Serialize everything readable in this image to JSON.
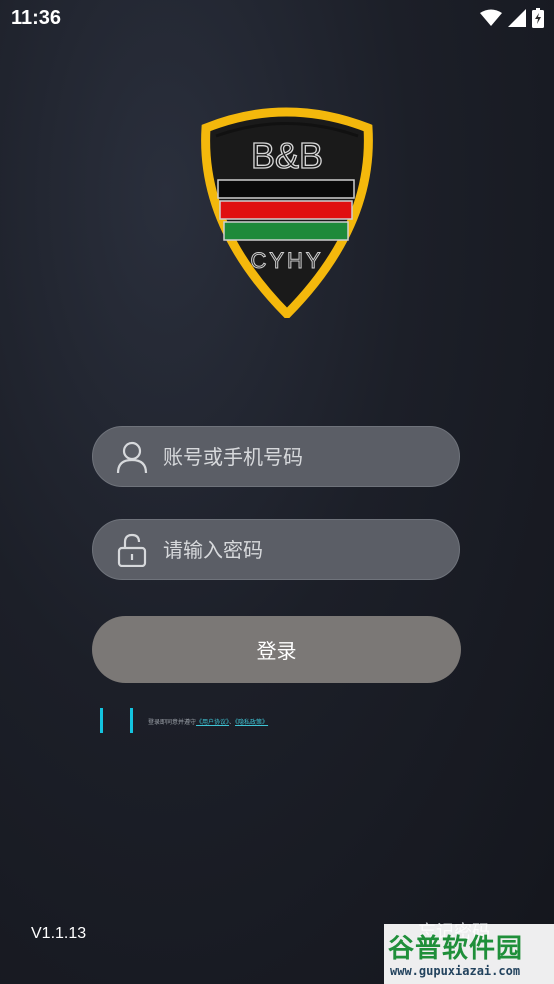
{
  "status_bar": {
    "time": "11:36",
    "icons": [
      "wifi-icon",
      "cellular-signal-icon",
      "battery-icon"
    ]
  },
  "logo": {
    "line1": "B&B",
    "line2": "CYHY",
    "colors": {
      "shield": "#f4b80c",
      "stripe_black": "#0a0a0a",
      "stripe_red": "#e01010",
      "stripe_green": "#1e8a3a"
    }
  },
  "form": {
    "account_placeholder": "账号或手机号码",
    "account_icon": "user-icon",
    "password_placeholder": "请输入密码",
    "password_icon": "unlock-icon",
    "login_label": "登录"
  },
  "agreement": {
    "text": "登录即同意并遵守",
    "link1": "《用户协议》",
    "separator": "、",
    "link2": "《隐私政策》"
  },
  "footer": {
    "version": "V1.1.13",
    "forgot_password": "忘记密码"
  },
  "watermark": {
    "title": "谷普软件园",
    "url": "www.gupuxiazai.com"
  },
  "colors": {
    "accent": "#13c4e0",
    "button": "#7b7876",
    "field": "#5b5e66"
  }
}
